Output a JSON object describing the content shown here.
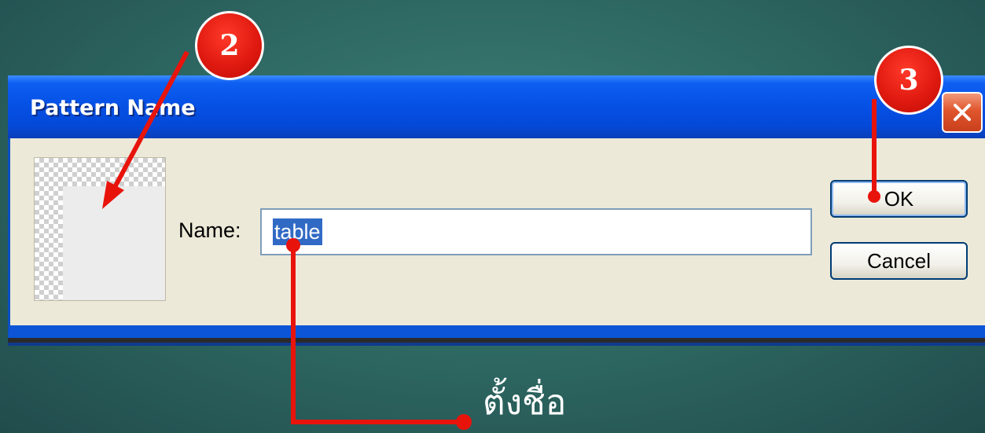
{
  "dialog": {
    "title": "Pattern Name",
    "name_label": "Name:",
    "name_value": "table",
    "ok_label": "OK",
    "cancel_label": "Cancel"
  },
  "annotations": {
    "step2": "2",
    "step3": "3",
    "caption": "ตั้งชื่อ"
  },
  "colors": {
    "titlebar": "#0651e6",
    "dialog_body": "#ece9d8",
    "annotation_red": "#e01a10",
    "selection": "#316ac5",
    "background": "#2f6a64"
  }
}
